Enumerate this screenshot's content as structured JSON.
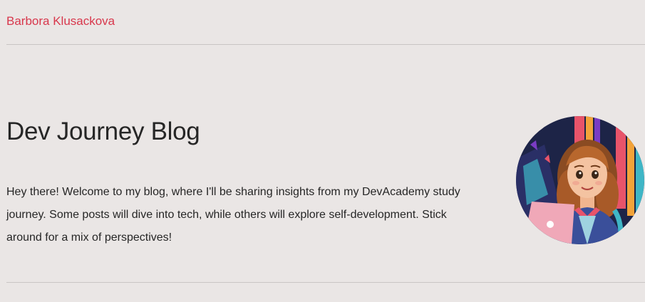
{
  "header": {
    "site_name": "Barbora Klusackova"
  },
  "hero": {
    "title": "Dev Journey Blog",
    "intro": "Hey there! Welcome to my blog, where I'll be sharing insights from my DevAcademy study journey. Some posts will dive into tech, while others will explore self-development. Stick around for a mix of perspectives!"
  },
  "avatar": {
    "icon": "avatar-illustration",
    "accent_colors": [
      "#1d2447",
      "#e8546a",
      "#f2a33a",
      "#3fb6c6",
      "#7a3cc4"
    ]
  },
  "colors": {
    "background": "#eae6e5",
    "brand": "#d8374c",
    "text": "#262626",
    "divider": "#c9c5c4"
  }
}
